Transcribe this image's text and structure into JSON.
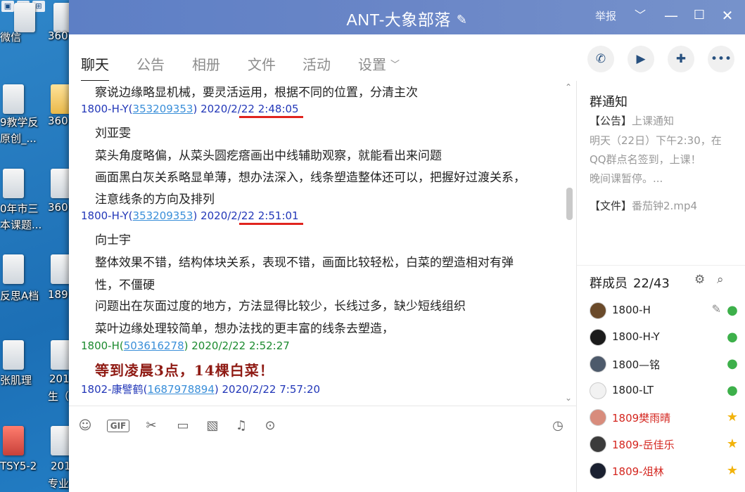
{
  "desktop": {
    "icons": [
      {
        "label": "微信"
      },
      {
        "label": "360"
      },
      {
        "label": "9教学反"
      },
      {
        "label": "原创_..."
      },
      {
        "label": "360"
      },
      {
        "label": "0年市三"
      },
      {
        "label": "本课题..."
      },
      {
        "label": "360"
      },
      {
        "label": "反思A档"
      },
      {
        "label": "189"
      },
      {
        "label": "张肌理"
      },
      {
        "label": "201"
      },
      {
        "label": "生（"
      },
      {
        "label": "TSY5-2"
      },
      {
        "label": "201"
      },
      {
        "label": "专业"
      }
    ]
  },
  "window": {
    "title": "ANT-大象部落",
    "report_label": "举报",
    "colors": {
      "titlebar": "#6a86c7",
      "accent_red": "#e0241e",
      "link": "#3a8fd9"
    }
  },
  "tabs": [
    {
      "label": "聊天",
      "active": true
    },
    {
      "label": "公告"
    },
    {
      "label": "相册"
    },
    {
      "label": "文件"
    },
    {
      "label": "活动"
    },
    {
      "label": "设置"
    }
  ],
  "header_actions": [
    "phone-icon",
    "video-icon",
    "add-chat-icon",
    "more-icon"
  ],
  "chat": {
    "lines": [
      {
        "kind": "text",
        "text": "察说边缘略显机械，要灵活运用，根据不同的位置，分清主次"
      },
      {
        "kind": "header",
        "color": "blue",
        "sender": "1800-H-Y",
        "qq": "353209353",
        "date": "2020/2/22",
        "time": "2:48:05",
        "underlined": true
      },
      {
        "kind": "text",
        "text": "刘亚雯"
      },
      {
        "kind": "text",
        "text": "菜头角度略偏，从菜头圆疙瘩画出中线辅助观察，就能看出来问题"
      },
      {
        "kind": "text",
        "text": "画面黑白灰关系略显单薄，想办法深入，线条塑造整体还可以，把握好过渡关系，"
      },
      {
        "kind": "text",
        "text": "注意线条的方向及排列"
      },
      {
        "kind": "header",
        "color": "blue",
        "sender": "1800-H-Y",
        "qq": "353209353",
        "date": "2020/2/22",
        "time": "2:51:01",
        "underlined": true
      },
      {
        "kind": "text",
        "text": "向士宇"
      },
      {
        "kind": "text",
        "text": "整体效果不错，结构体块关系，表现不错，画面比较轻松，白菜的塑造相对有弹"
      },
      {
        "kind": "text",
        "text": "性，不僵硬"
      },
      {
        "kind": "text",
        "text": "问题出在灰面过度的地方，方法显得比较少，长线过多，缺少短线组织"
      },
      {
        "kind": "text",
        "text": "菜叶边缘处理较简单，想办法找的更丰富的线条去塑造，"
      },
      {
        "kind": "header",
        "color": "green",
        "sender": "1800-H",
        "qq": "503616278",
        "date": "2020/2/22",
        "time": "2:52:27"
      },
      {
        "kind": "big",
        "text": "等到凌晨3点，14棵白菜！"
      },
      {
        "kind": "header",
        "color": "blue",
        "sender": "1802-康譬鹤",
        "qq": "1687978894",
        "date": "2020/2/22",
        "time": "7:57:20"
      }
    ]
  },
  "toolbar": [
    "smile-icon",
    "gif-icon",
    "scissors-icon",
    "folder-icon",
    "image-icon",
    "bell-icon",
    "more-circle-icon",
    "history-clock-icon"
  ],
  "notice": {
    "title": "群通知",
    "lines": [
      {
        "tag": "【公告】",
        "text": "上课通知"
      },
      {
        "tag": "",
        "text": "明天（22日）下午2:30，在"
      },
      {
        "tag": "",
        "text": "QQ群点名签到，上课！"
      },
      {
        "tag": "",
        "text": "晚间课暂停。..."
      },
      {
        "tag": "【文件】",
        "text": "番茄钟2.mp4"
      }
    ]
  },
  "members": {
    "title": "群成员",
    "count": "22/43",
    "list": [
      {
        "name": "1800-H",
        "role": "person",
        "color": "normal",
        "editable": true
      },
      {
        "name": "1800-H-Y",
        "role": "person",
        "color": "normal"
      },
      {
        "name": "1800—铭",
        "role": "person-star",
        "color": "normal"
      },
      {
        "name": "1800-LT",
        "role": "person",
        "color": "normal"
      },
      {
        "name": "1809樊雨晴",
        "role": "star",
        "color": "red"
      },
      {
        "name": "1809-岳佳乐",
        "role": "star",
        "color": "red"
      },
      {
        "name": "1809-俎林",
        "role": "star",
        "color": "red"
      }
    ]
  }
}
